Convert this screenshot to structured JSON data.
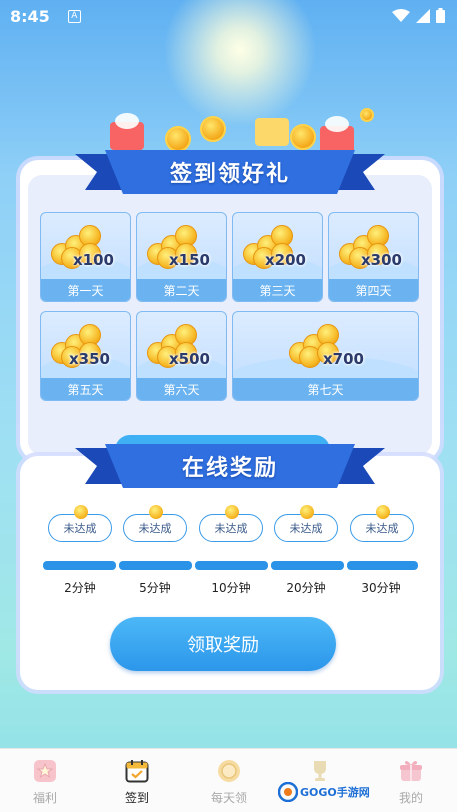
{
  "status_bar": {
    "time": "8:45",
    "notif_glyph": "A"
  },
  "checkin": {
    "title": "签到领好礼",
    "days": [
      {
        "label": "第一天",
        "amount": "x100"
      },
      {
        "label": "第二天",
        "amount": "x150"
      },
      {
        "label": "第三天",
        "amount": "x200"
      },
      {
        "label": "第四天",
        "amount": "x300"
      },
      {
        "label": "第五天",
        "amount": "x350"
      },
      {
        "label": "第六天",
        "amount": "x500"
      },
      {
        "label": "第七天",
        "amount": "x700"
      }
    ]
  },
  "online": {
    "title": "在线奖励",
    "rewards": [
      {
        "status": "未达成",
        "time": "2分钟"
      },
      {
        "status": "未达成",
        "time": "5分钟"
      },
      {
        "status": "未达成",
        "time": "10分钟"
      },
      {
        "status": "未达成",
        "time": "20分钟"
      },
      {
        "status": "未达成",
        "time": "30分钟"
      }
    ],
    "claim_label": "领取奖励"
  },
  "nav": {
    "items": [
      {
        "label": "福利",
        "icon": "star-icon"
      },
      {
        "label": "签到",
        "icon": "calendar-check-icon"
      },
      {
        "label": "每天领",
        "icon": "coin-icon"
      },
      {
        "label": "",
        "icon": "trophy-icon"
      },
      {
        "label": "我的",
        "icon": "gift-box-icon"
      }
    ],
    "active_index": 1
  },
  "watermark": {
    "text": "GOGO手游网"
  },
  "colors": {
    "accent": "#2c96ea",
    "ribbon": "#2f6fe0"
  }
}
